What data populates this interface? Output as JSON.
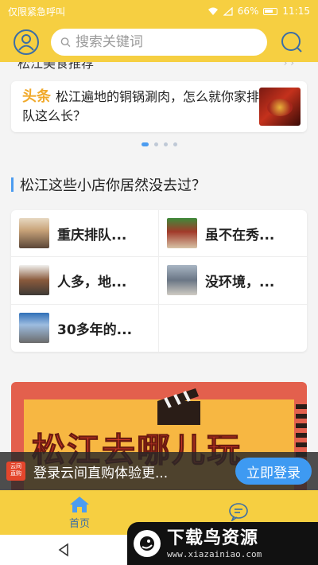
{
  "status_bar": {
    "carrier": "仅限紧急呼叫",
    "battery_percent": "66%",
    "time": "11:15"
  },
  "header": {
    "search_placeholder": "搜索关键词"
  },
  "headline": {
    "cut_title": "松江美食推荐",
    "tag": "头条",
    "text": "松江遍地的铜锅涮肉，怎么就你家排队这么长？"
  },
  "carousel": {
    "count": 4,
    "active": 0
  },
  "shops_section": {
    "title": "松江这些小店你居然没去过？",
    "items": [
      {
        "name": "重庆排队..."
      },
      {
        "name": "虽不在秀..."
      },
      {
        "name": "人多，地..."
      },
      {
        "name": "没环境，..."
      },
      {
        "name": "30多年的..."
      }
    ]
  },
  "banner": {
    "text": "松江去哪儿玩"
  },
  "login_prompt": {
    "logo_text": "云间\n直购",
    "text": "登录云间直购体验更...",
    "button_label": "立即登录"
  },
  "tabs": [
    {
      "label": "首页",
      "icon": "home-icon",
      "active": true
    },
    {
      "label": "",
      "icon": "chat-icon",
      "active": false
    }
  ],
  "watermark": {
    "title": "下载鸟资源",
    "url": "www.xiazainiao.com"
  },
  "colors": {
    "brand_yellow": "#f6cf41",
    "accent_blue": "#4c9cf0",
    "headline_orange": "#f0a92b"
  }
}
